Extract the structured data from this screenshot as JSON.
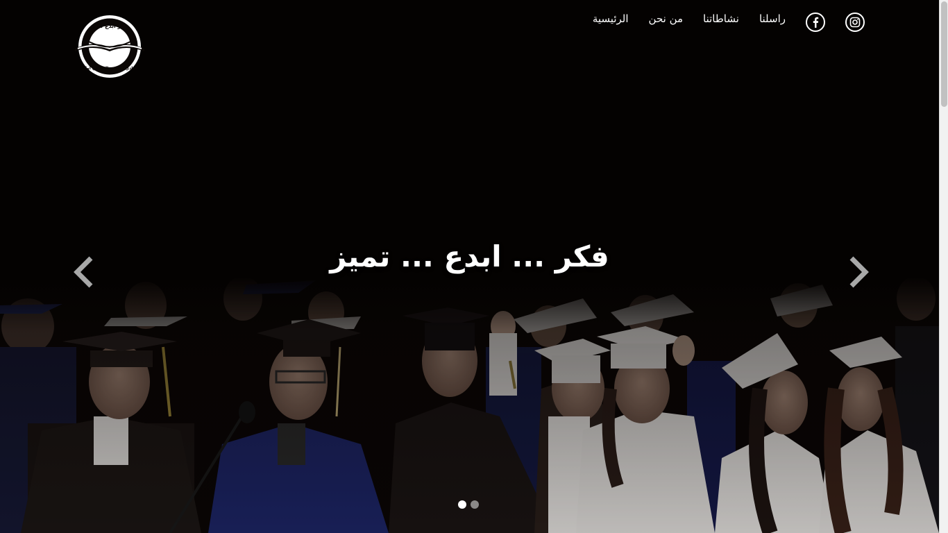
{
  "nav": {
    "logo": {
      "top_text": "فكر    ابدع    تميز",
      "bottom_text": "النادي العلمي الثقافي أوال"
    },
    "links": [
      {
        "label": "الرئيسية"
      },
      {
        "label": "من نحن"
      },
      {
        "label": "نشاطاتنا"
      },
      {
        "label": "راسلنا"
      }
    ],
    "social": [
      {
        "icon": "facebook-icon"
      },
      {
        "icon": "instagram-icon"
      }
    ]
  },
  "hero": {
    "headline": "فكر ... ابدع ... تميز",
    "slide_count": 2,
    "active_slide": 1
  },
  "colors": {
    "text": "#ffffff",
    "background": "#0a0604",
    "gown_black": "#1b1514",
    "gown_blue": "#1d2a6e",
    "gown_white": "#e9e6e3"
  }
}
